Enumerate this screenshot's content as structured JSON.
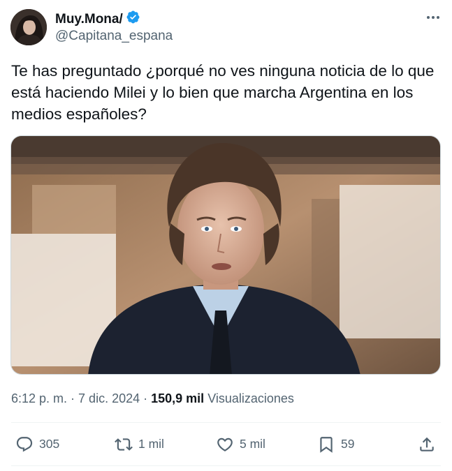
{
  "author": {
    "display_name": "Muy.Mona/",
    "handle": "@Capitana_espana",
    "verified_icon": "verified-badge-icon"
  },
  "more_icon": "more-horizontal-icon",
  "tweet": {
    "text": "Te has preguntado ¿porqué no ves ninguna noticia de lo que está haciendo Milei y lo bien que marcha Argentina en los medios españoles?"
  },
  "meta": {
    "time": "6:12 p. m.",
    "dot1": "·",
    "date": "7 dic. 2024",
    "dot2": "·",
    "views_count": "150,9 mil",
    "views_label": "Visualizaciones"
  },
  "actions": {
    "replies": "305",
    "retweets": "1 mil",
    "likes": "5 mil",
    "bookmarks": "59"
  },
  "colors": {
    "text_primary": "#0f1419",
    "text_secondary": "#536471",
    "verified_blue": "#1d9bf0",
    "divider": "#eff3f4"
  }
}
